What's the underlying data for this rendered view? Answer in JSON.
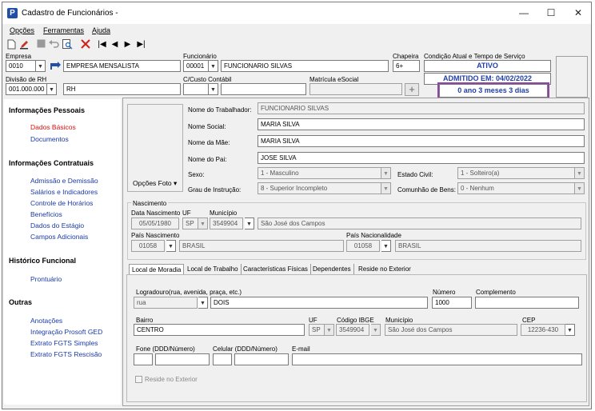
{
  "window": {
    "title": "Cadastro de Funcionários -",
    "minimize": "—",
    "maximize": "☐",
    "close": "✕"
  },
  "menu": {
    "opcoes": "Opções",
    "ferramentas": "Ferramentas",
    "ajuda": "Ajuda"
  },
  "toolbar": {
    "first": "|◀",
    "prev": "◀",
    "next": "▶",
    "last": "▶|"
  },
  "header": {
    "empresa_label": "Empresa",
    "empresa_code": "0010",
    "empresa_name": "EMPRESA MENSALISTA",
    "funcionario_label": "Funcionário",
    "funcionario_code": "00001",
    "funcionario_name": "FUNCIONARIO SILVAS",
    "chapeira_label": "Chapeira",
    "chapeira_value": "6+",
    "divisao_label": "Divisão de RH",
    "divisao_code": "001.000.000",
    "divisao_name": "RH",
    "custo_label": "C/Custo Contábil",
    "matricula_label": "Matrícula eSocial",
    "condicao_label": "Condição Atual e Tempo de Serviço",
    "status": "ATIVO",
    "admitido": "ADMITIDO EM: 04/02/2022",
    "tempo": "0 ano 3 meses 3 dias",
    "plus": "+"
  },
  "sidebar": {
    "sections": [
      {
        "title": "Informações Pessoais",
        "items": [
          "Dados Básicos",
          "Documentos"
        ]
      },
      {
        "title": "Informações Contratuais",
        "items": [
          "Admissão e Demissão",
          "Salários e Indicadores",
          "Controle de Horários",
          "Benefícios",
          "Dados do Estágio",
          "Campos Adicionais"
        ]
      },
      {
        "title": "Histórico Funcional",
        "items": [
          "Prontuário"
        ]
      },
      {
        "title": "Outras",
        "items": [
          "Anotações",
          "Integração Prosoft GED",
          "Extrato FGTS Simples",
          "Extrato FGTS Rescisão"
        ]
      }
    ]
  },
  "basic": {
    "photo_button": "Opções Foto ▾",
    "nome_trab_label": "Nome do Trabalhador:",
    "nome_trab": "FUNCIONARIO SILVAS",
    "nome_social_label": "Nome Social:",
    "nome_social": "MARIA SILVA",
    "nome_mae_label": "Nome da Mãe:",
    "nome_mae": "MARIA SILVA",
    "nome_pai_label": "Nome do Pai:",
    "nome_pai": "JOSE SILVA",
    "sexo_label": "Sexo:",
    "sexo": "1 - Masculino",
    "estado_civil_label": "Estado Civil:",
    "estado_civil": "1 - Solteiro(a)",
    "grau_label": "Grau de Instrução:",
    "grau": "8 - Superior Incompleto",
    "comunhao_label": "Comunhão de Bens:",
    "comunhao": "0 - Nenhum"
  },
  "nascimento": {
    "group_label": "Nascimento",
    "data_label": "Data Nascimento",
    "data": "05/05/1980",
    "uf_label": "UF",
    "uf": "SP",
    "municipio_label": "Município",
    "municipio_code": "3549904",
    "municipio_name": "São José dos Campos",
    "pais_label": "País Nascimento",
    "pais_code": "01058",
    "pais_name": "BRASIL",
    "nacionalidade_label": "País Nacionalidade",
    "nacionalidade_code": "01058",
    "nacionalidade_name": "BRASIL"
  },
  "tabs": [
    "Local de Moradia",
    "Local de Trabalho",
    "Características Físicas",
    "Dependentes",
    "Reside no Exterior"
  ],
  "moradia": {
    "logradouro_label": "Logradouro(rua, avenida, praça, etc.)",
    "tipo": "rua",
    "logradouro": "DOIS",
    "numero_label": "Número",
    "numero": "1000",
    "complemento_label": "Complemento",
    "bairro_label": "Bairro",
    "bairro": "CENTRO",
    "uf_label": "UF",
    "uf": "SP",
    "ibge_label": "Código IBGE",
    "ibge": "3549904",
    "municipio_label": "Município",
    "municipio": "São José dos Campos",
    "cep_label": "CEP",
    "cep": "12236-430",
    "fone_label": "Fone (DDD/Número)",
    "celular_label": "Celular (DDD/Número)",
    "email_label": "E-mail",
    "reside_label": "Reside no Exterior"
  }
}
